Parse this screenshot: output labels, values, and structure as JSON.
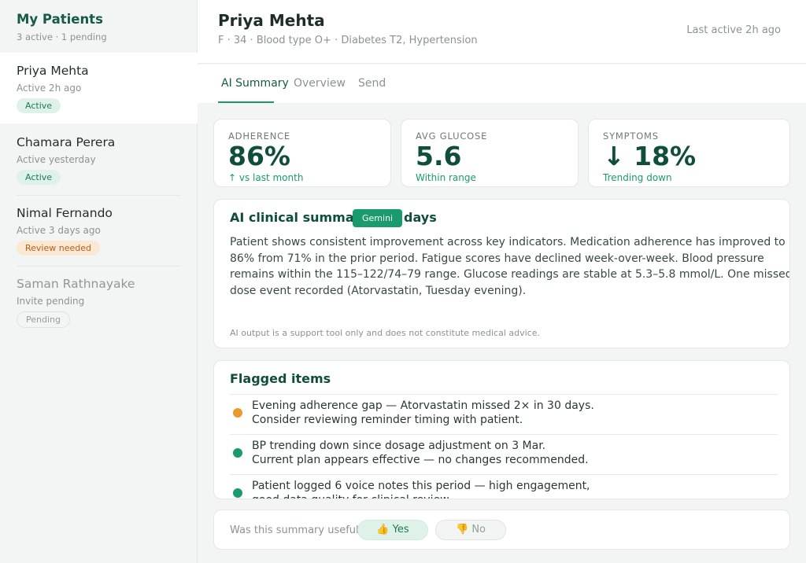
{
  "sidebar": {
    "title": "My Patients",
    "subtitle": "3 active · 1 pending",
    "patients": [
      {
        "name": "Priya Mehta",
        "status": "Active 2h ago",
        "badge": "Active"
      },
      {
        "name": "Chamara Perera",
        "status": "Active yesterday",
        "badge": "Active"
      },
      {
        "name": "Nimal Fernando",
        "status": "Active 3 days ago",
        "badge": "Review needed"
      },
      {
        "name": "Saman Rathnayake",
        "status": "Invite pending",
        "badge": "Pending"
      }
    ]
  },
  "header": {
    "name": "Priya Mehta",
    "meta": "F · 34 · Blood type O+ · Diabetes T2, Hypertension",
    "last_active": "Last active 2h ago"
  },
  "tabs": [
    "AI Summary",
    "Overview",
    "Send"
  ],
  "stats": [
    {
      "label": "ADHERENCE",
      "value": "86%",
      "note": "↑ vs last month"
    },
    {
      "label": "AVG GLUCOSE",
      "value": "5.6",
      "note": "Within range"
    },
    {
      "label": "SYMPTOMS",
      "value": "↓ 18%",
      "note": "Trending down"
    }
  ],
  "summary": {
    "title": "AI clinical summary · 30 days",
    "badge": "Gemini",
    "text": "Patient shows consistent improvement across key indicators. Medication adherence has improved to 86% from 71% in the prior period. Fatigue scores have declined week-over-week. Blood pressure remains within the 115–122/74–79 range. Glucose readings are stable at 5.3–5.8 mmol/L. One missed dose event recorded (Atorvastatin, Tuesday evening).",
    "disclaimer": "AI output is a support tool only and does not constitute medical advice."
  },
  "flagged": {
    "title": "Flagged items",
    "items": [
      {
        "line1": "Evening adherence gap — Atorvastatin missed 2× in 30 days.",
        "line2": "Consider reviewing reminder timing with patient.",
        "color": "#e89a2c"
      },
      {
        "line1": "BP trending down since dosage adjustment on 3 Mar.",
        "line2": "Current plan appears effective — no changes recommended.",
        "color": "#1a9b6e"
      },
      {
        "line1": "Patient logged 6 voice notes this period — high engagement,",
        "line2": "good data quality for clinical review.",
        "color": "#1a9b6e"
      }
    ]
  },
  "feedback": {
    "question": "Was this summary useful?",
    "yes": "👍 Yes",
    "no": "👎 No"
  }
}
